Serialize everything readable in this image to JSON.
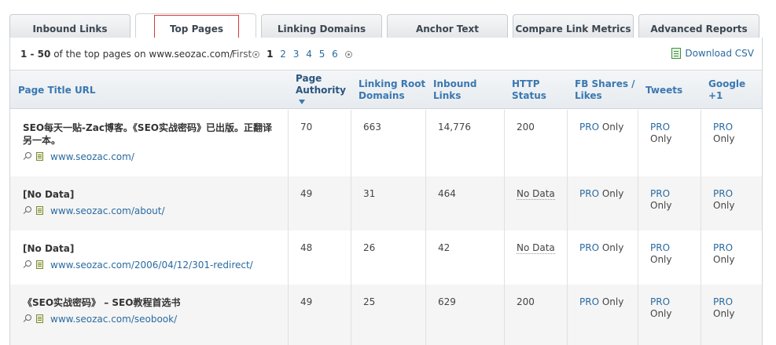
{
  "tabs": [
    {
      "label": "Inbound Links",
      "active": false
    },
    {
      "label": "Top Pages",
      "active": true
    },
    {
      "label": "Linking Domains",
      "active": false
    },
    {
      "label": "Anchor Text",
      "active": false
    },
    {
      "label": "Compare Link Metrics",
      "active": false
    },
    {
      "label": "Advanced Reports",
      "active": false
    }
  ],
  "pager": {
    "range": "1 - 50",
    "summary": "of the top pages on www.seozac.com/",
    "first_label": "First",
    "pages": [
      "1",
      "2",
      "3",
      "4",
      "5",
      "6"
    ],
    "current_page": "1"
  },
  "download": {
    "label": "Download CSV"
  },
  "columns": {
    "title_url": "Page Title URL",
    "page_authority": "Page Authority",
    "linking_root_domains": "Linking Root Domains",
    "inbound_links": "Inbound Links",
    "http_status": "HTTP Status",
    "fb": "FB Shares / Likes",
    "tweets": "Tweets",
    "google_plus": "Google +1"
  },
  "pro_label": "PRO",
  "only_label": "Only",
  "rows": [
    {
      "title": "SEO每天一贴-Zac博客。《SEO实战密码》已出版。正翻译另一本。",
      "url": "www.seozac.com/",
      "page_authority": "70",
      "linking_root_domains": "663",
      "inbound_links": "14,776",
      "http_status": "200"
    },
    {
      "title": "[No Data]",
      "url": "www.seozac.com/about/",
      "page_authority": "49",
      "linking_root_domains": "31",
      "inbound_links": "464",
      "http_status": "No Data"
    },
    {
      "title": "[No Data]",
      "url": "www.seozac.com/2006/04/12/301-redirect/",
      "page_authority": "48",
      "linking_root_domains": "26",
      "inbound_links": "42",
      "http_status": "No Data"
    },
    {
      "title": "《SEO实战密码》 – SEO教程首选书",
      "url": "www.seozac.com/seobook/",
      "page_authority": "49",
      "linking_root_domains": "25",
      "inbound_links": "629",
      "http_status": "200"
    }
  ]
}
